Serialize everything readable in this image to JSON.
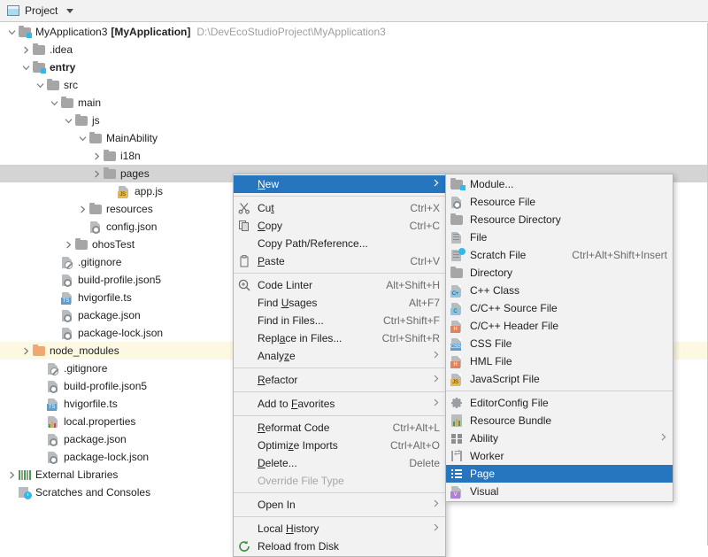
{
  "toolwindow": {
    "title": "Project",
    "icon": "project-window-icon",
    "dropdown_icon": "chevron-down-icon"
  },
  "tree": {
    "rows": [
      {
        "indent": 0,
        "arrow": "down",
        "icon": "module-folder-icon",
        "label": "MyApplication3",
        "bracket": "[MyApplication]",
        "path": "D:\\DevEcoStudioProject\\MyApplication3",
        "bold": false,
        "state": "normal"
      },
      {
        "indent": 1,
        "arrow": "right",
        "icon": "folder-icon",
        "label": ".idea",
        "state": "normal"
      },
      {
        "indent": 1,
        "arrow": "down",
        "icon": "module-folder-icon",
        "label": "entry",
        "bold": true,
        "state": "normal"
      },
      {
        "indent": 2,
        "arrow": "down",
        "icon": "folder-icon",
        "label": "src",
        "state": "normal"
      },
      {
        "indent": 3,
        "arrow": "down",
        "icon": "folder-icon",
        "label": "main",
        "state": "normal"
      },
      {
        "indent": 4,
        "arrow": "down",
        "icon": "folder-icon",
        "label": "js",
        "state": "normal"
      },
      {
        "indent": 5,
        "arrow": "down",
        "icon": "folder-icon",
        "label": "MainAbility",
        "state": "normal"
      },
      {
        "indent": 6,
        "arrow": "right",
        "icon": "folder-icon",
        "label": "i18n",
        "state": "normal"
      },
      {
        "indent": 6,
        "arrow": "right",
        "icon": "folder-icon",
        "label": "pages",
        "state": "selected"
      },
      {
        "indent": 7,
        "arrow": "none",
        "icon": "js-file-icon",
        "label": "app.js",
        "state": "normal"
      },
      {
        "indent": 5,
        "arrow": "right",
        "icon": "folder-icon",
        "label": "resources",
        "state": "normal"
      },
      {
        "indent": 5,
        "arrow": "none",
        "icon": "json-file-icon",
        "label": "config.json",
        "state": "normal"
      },
      {
        "indent": 4,
        "arrow": "right",
        "icon": "folder-icon",
        "label": "ohosTest",
        "state": "normal"
      },
      {
        "indent": 3,
        "arrow": "none",
        "icon": "gitignore-file-icon",
        "label": ".gitignore",
        "state": "normal"
      },
      {
        "indent": 3,
        "arrow": "none",
        "icon": "json-file-icon",
        "label": "build-profile.json5",
        "state": "normal"
      },
      {
        "indent": 3,
        "arrow": "none",
        "icon": "ts-file-icon",
        "label": "hvigorfile.ts",
        "state": "normal"
      },
      {
        "indent": 3,
        "arrow": "none",
        "icon": "json-file-icon",
        "label": "package.json",
        "state": "normal"
      },
      {
        "indent": 3,
        "arrow": "none",
        "icon": "json-file-icon",
        "label": "package-lock.json",
        "state": "normal"
      },
      {
        "indent": 1,
        "arrow": "right",
        "icon": "node-modules-folder-icon",
        "label": "node_modules",
        "state": "marked"
      },
      {
        "indent": 2,
        "arrow": "none",
        "icon": "gitignore-file-icon",
        "label": ".gitignore",
        "state": "normal"
      },
      {
        "indent": 2,
        "arrow": "none",
        "icon": "json-file-icon",
        "label": "build-profile.json5",
        "state": "normal"
      },
      {
        "indent": 2,
        "arrow": "none",
        "icon": "ts-file-icon",
        "label": "hvigorfile.ts",
        "state": "normal"
      },
      {
        "indent": 2,
        "arrow": "none",
        "icon": "properties-file-icon",
        "label": "local.properties",
        "state": "normal"
      },
      {
        "indent": 2,
        "arrow": "none",
        "icon": "json-file-icon",
        "label": "package.json",
        "state": "normal"
      },
      {
        "indent": 2,
        "arrow": "none",
        "icon": "json-file-icon",
        "label": "package-lock.json",
        "state": "normal"
      },
      {
        "indent": 0,
        "arrow": "right",
        "icon": "external-libraries-icon",
        "label": "External Libraries",
        "state": "normal"
      },
      {
        "indent": 0,
        "arrow": "none",
        "icon": "scratches-icon",
        "label": "Scratches and Consoles",
        "state": "normal"
      }
    ]
  },
  "context_menu": {
    "items": [
      {
        "label": "New",
        "mnemonic": "N",
        "icon": null,
        "accel": "",
        "submenu": true,
        "selected": true
      },
      {
        "separator": true
      },
      {
        "label": "Cut",
        "mnemonic": "t",
        "icon": "scissors-icon",
        "accel": "Ctrl+X"
      },
      {
        "label": "Copy",
        "mnemonic": "C",
        "icon": "copy-icon",
        "accel": "Ctrl+C"
      },
      {
        "label": "Copy Path/Reference...",
        "icon": null,
        "accel": ""
      },
      {
        "label": "Paste",
        "mnemonic": "P",
        "icon": "paste-icon",
        "accel": "Ctrl+V"
      },
      {
        "separator": true
      },
      {
        "label": "Code Linter",
        "icon": "code-linter-icon",
        "accel": "Alt+Shift+H"
      },
      {
        "label": "Find Usages",
        "mnemonic": "U",
        "icon": null,
        "accel": "Alt+F7"
      },
      {
        "label": "Find in Files...",
        "icon": null,
        "accel": "Ctrl+Shift+F"
      },
      {
        "label": "Replace in Files...",
        "mnemonic": "a",
        "icon": null,
        "accel": "Ctrl+Shift+R"
      },
      {
        "label": "Analyze",
        "mnemonic": "z",
        "icon": null,
        "accel": "",
        "submenu": true
      },
      {
        "separator": true
      },
      {
        "label": "Refactor",
        "mnemonic": "R",
        "icon": null,
        "accel": "",
        "submenu": true
      },
      {
        "separator": true
      },
      {
        "label": "Add to Favorites",
        "mnemonic": "F",
        "icon": null,
        "accel": "",
        "submenu": true
      },
      {
        "separator": true
      },
      {
        "label": "Reformat Code",
        "mnemonic": "R",
        "icon": null,
        "accel": "Ctrl+Alt+L"
      },
      {
        "label": "Optimize Imports",
        "mnemonic": "z",
        "icon": null,
        "accel": "Ctrl+Alt+O"
      },
      {
        "label": "Delete...",
        "mnemonic": "D",
        "icon": null,
        "accel": "Delete"
      },
      {
        "label": "Override File Type",
        "icon": null,
        "accel": "",
        "disabled": true
      },
      {
        "separator": true
      },
      {
        "label": "Open In",
        "icon": null,
        "accel": "",
        "submenu": true
      },
      {
        "separator": true
      },
      {
        "label": "Local History",
        "mnemonic": "H",
        "icon": null,
        "accel": "",
        "submenu": true
      },
      {
        "label": "Reload from Disk",
        "icon": "reload-icon",
        "accel": ""
      }
    ]
  },
  "new_submenu": {
    "items": [
      {
        "label": "Module...",
        "icon": "module-folder-icon",
        "accel": ""
      },
      {
        "label": "Resource File",
        "icon": "json-file-icon",
        "accel": ""
      },
      {
        "label": "Resource Directory",
        "icon": "folder-icon",
        "accel": ""
      },
      {
        "label": "File",
        "icon": "file-icon",
        "accel": ""
      },
      {
        "label": "Scratch File",
        "icon": "scratch-file-icon",
        "accel": "Ctrl+Alt+Shift+Insert"
      },
      {
        "label": "Directory",
        "icon": "folder-icon",
        "accel": ""
      },
      {
        "label": "C++ Class",
        "icon": "cpp-class-file-icon",
        "accel": ""
      },
      {
        "label": "C/C++ Source File",
        "icon": "c-source-file-icon",
        "accel": ""
      },
      {
        "label": "C/C++ Header File",
        "icon": "h-header-file-icon",
        "accel": ""
      },
      {
        "label": "CSS File",
        "icon": "css-file-icon",
        "accel": ""
      },
      {
        "label": "HML File",
        "icon": "hml-file-icon",
        "accel": ""
      },
      {
        "label": "JavaScript File",
        "icon": "js-file-icon",
        "accel": ""
      },
      {
        "separator": true
      },
      {
        "label": "EditorConfig File",
        "icon": "gear-icon",
        "accel": ""
      },
      {
        "label": "Resource Bundle",
        "icon": "resource-bundle-icon",
        "accel": ""
      },
      {
        "label": "Ability",
        "icon": "ability-icon",
        "accel": "",
        "submenu": true
      },
      {
        "label": "Worker",
        "icon": "worker-icon",
        "accel": ""
      },
      {
        "label": "Page",
        "icon": "page-icon",
        "accel": "",
        "selected": true
      },
      {
        "label": "Visual",
        "icon": "visual-file-icon",
        "accel": ""
      }
    ]
  },
  "colors": {
    "selection_blue": "#2675bf",
    "tree_selection_grey": "#d4d4d4",
    "marked_row_yellow": "#fcf8e2",
    "menu_bg": "#f2f2f2",
    "path_text": "#a0a0a0"
  }
}
